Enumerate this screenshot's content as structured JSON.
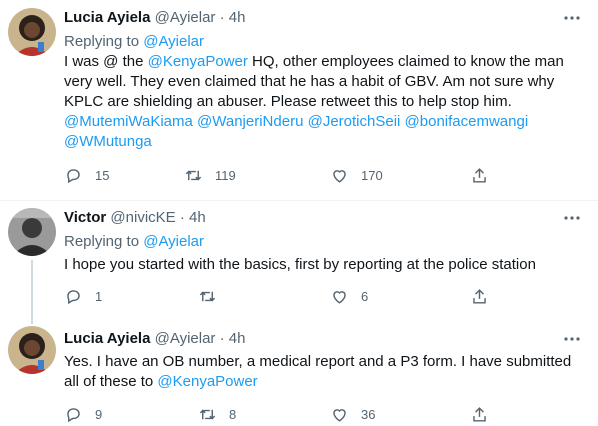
{
  "tweets": [
    {
      "name": "Lucia Ayiela",
      "handle": "@Ayielar",
      "dot": "·",
      "time": "4h",
      "replying_prefix": "Replying to ",
      "replying_handle": "@Ayielar",
      "text": {
        "p1": "I was @ the ",
        "mention1": "@KenyaPower",
        "p2": " HQ, other employees claimed to know the man very well. They even claimed that he has a habit of GBV. Am not sure why KPLC are shielding an abuser. Please retweet this to help stop him.",
        "mentions": [
          "@MutemiWaKiama",
          "@WanjeriNderu",
          "@JerotichSeii",
          "@bonifacemwangi",
          "@WMutunga"
        ]
      },
      "replies": "15",
      "retweets": "119",
      "likes": "170"
    },
    {
      "name": "Victor",
      "handle": "@nivicKE",
      "dot": "·",
      "time": "4h",
      "replying_prefix": "Replying to ",
      "replying_handle": "@Ayielar",
      "text": "I hope you started with the basics, first by reporting at the police station",
      "replies": "1",
      "retweets": "",
      "likes": "6"
    },
    {
      "name": "Lucia Ayiela",
      "handle": "@Ayielar",
      "dot": "·",
      "time": "4h",
      "text": {
        "p1": "Yes. I have an OB number, a medical report and a P3 form. I have submitted all of these to ",
        "mention1": "@KenyaPower"
      },
      "replies": "9",
      "retweets": "8",
      "likes": "36"
    }
  ],
  "colors": {
    "link": "#1d9bf0",
    "secondary": "#536471",
    "primary": "#0f1419",
    "divider": "#eff3f4"
  },
  "icons": [
    "reply-icon",
    "retweet-icon",
    "like-icon",
    "share-icon",
    "more-icon"
  ]
}
